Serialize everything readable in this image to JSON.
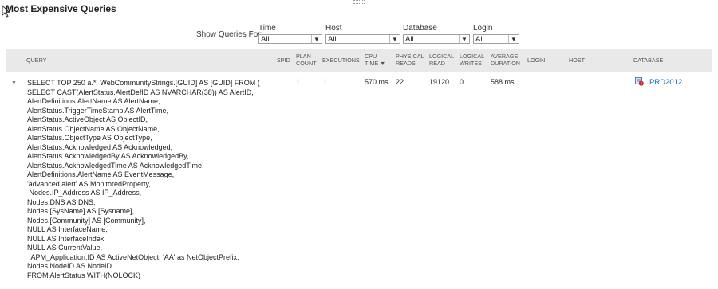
{
  "page": {
    "title": "Most Expensive Queries"
  },
  "filters": {
    "label": "Show Queries For:",
    "time": {
      "label": "Time",
      "value": "All"
    },
    "host": {
      "label": "Host",
      "value": "All"
    },
    "database": {
      "label": "Database",
      "value": "All"
    },
    "login": {
      "label": "Login",
      "value": "All"
    }
  },
  "table": {
    "headers": {
      "query": "QUERY",
      "spid": "SPID",
      "plan_count": [
        "PLAN",
        "COUNT"
      ],
      "executions": "EXECUTIONS",
      "cpu_time": [
        "CPU",
        "TIME"
      ],
      "physical_reads": [
        "PHYSICAL",
        "READS"
      ],
      "logical_read": [
        "LOGICAL",
        "READ"
      ],
      "logical_writes": [
        "LOGICAL",
        "WRITES"
      ],
      "average_duration": [
        "AVERAGE",
        "DURATION"
      ],
      "login": "LOGIN",
      "host": "HOST",
      "database": "DATABASE"
    },
    "sort": {
      "column": "cpu_time",
      "direction": "desc",
      "icon": "sort-desc-icon"
    },
    "rows": [
      {
        "spid": "",
        "plan_count": "1",
        "executions": "1",
        "cpu_time": "570 ms",
        "physical_reads": "22",
        "logical_read": "19120",
        "logical_writes": "0",
        "average_duration": "588 ms",
        "login": "",
        "host": "",
        "database": "PRD2012",
        "database_icon": "database-error-icon",
        "query_lines": [
          "SELECT TOP 250 a.*, WebCommunityStrings.[GUID] AS [GUID] FROM (",
          "SELECT CAST(AlertStatus.AlertDefID AS NVARCHAR(38)) AS AlertID,",
          "AlertDefinitions.AlertName AS AlertName,",
          "AlertStatus.TriggerTimeStamp AS AlertTime,",
          "AlertStatus.ActiveObject AS ObjectID,",
          "AlertStatus.ObjectName AS ObjectName,",
          "AlertStatus.ObjectType AS ObjectType,",
          "AlertStatus.Acknowledged AS Acknowledged,",
          "AlertStatus.AcknowledgedBy AS AcknowledgedBy,",
          "AlertStatus.AcknowledgedTime AS AcknowledgedTime,",
          "AlertDefinitions.AlertName AS EventMessage,",
          "'advanced alert' AS MonitoredProperty,",
          " Nodes.IP_Address AS IP_Address,",
          "Nodes.DNS AS DNS,",
          "Nodes.[SysName] AS [Sysname],",
          "Nodes.[Community] AS [Community],",
          "NULL AS InterfaceName,",
          "NULL AS InterfaceIndex,",
          "NULL AS CurrentValue,",
          "  APM_Application.ID AS ActiveNetObject, 'AA' as NetObjectPrefix,",
          "Nodes.NodeID AS NodeID",
          "FROM AlertStatus WITH(NOLOCK)"
        ]
      }
    ]
  },
  "colors": {
    "header_bg": "#e9e9e9",
    "link": "#0a6ab0",
    "error": "#d21f1f"
  }
}
